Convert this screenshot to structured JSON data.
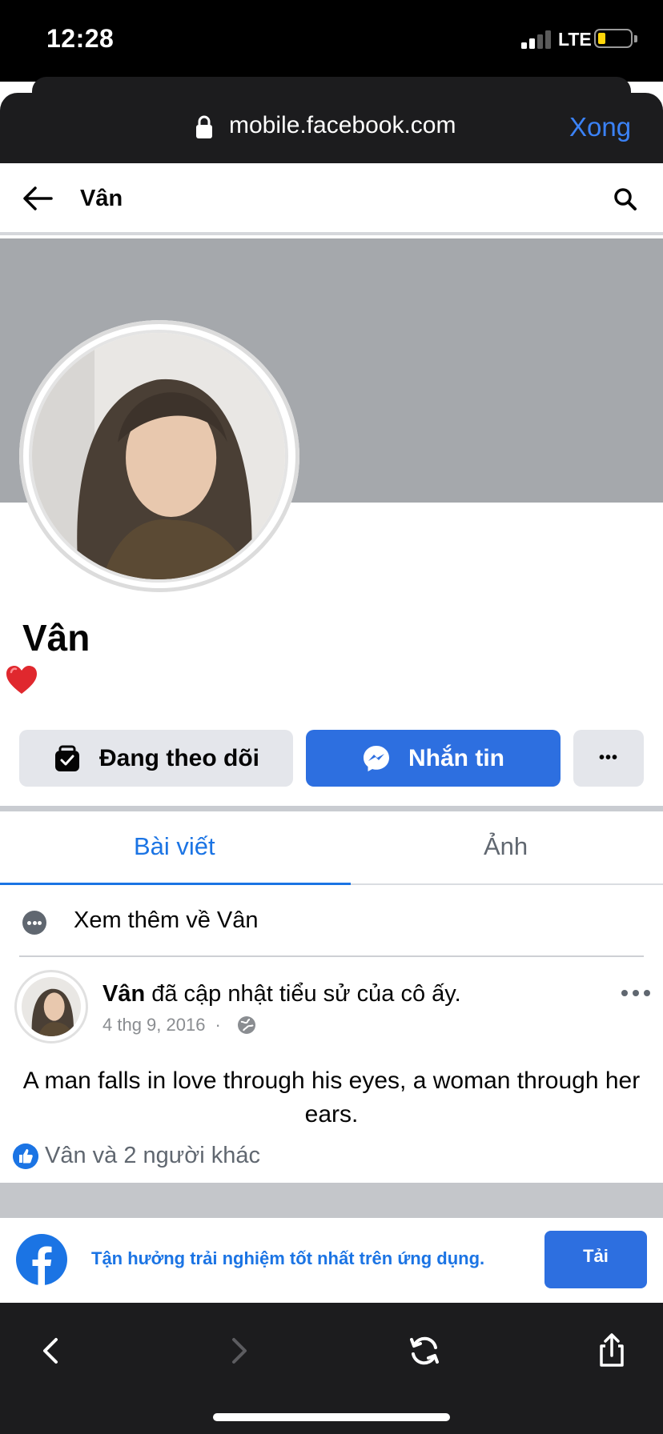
{
  "status_bar": {
    "time": "12:28",
    "network": "LTE",
    "battery_level": 0.15,
    "battery_color": "#ffd60a"
  },
  "browser": {
    "url": "mobile.facebook.com",
    "done_label": "Xong"
  },
  "topbar": {
    "title": "Vân"
  },
  "profile": {
    "name": "Vân",
    "bio_emoji": "heart-icon",
    "follow_label": "Đang theo dõi",
    "message_label": "Nhắn tin",
    "more_label": "•••"
  },
  "tabs": [
    {
      "label": "Bài viết",
      "active": true
    },
    {
      "label": "Ảnh",
      "active": false
    }
  ],
  "see_more": {
    "label": "Xem thêm về Vân"
  },
  "post": {
    "author": "Vân",
    "action": " đã cập nhật tiểu sử của cô ấy.",
    "date": "4 thg 9, 2016",
    "separator": "·",
    "privacy_icon": "globe-icon",
    "body": "A man falls in love through his eyes, a woman through her ears.",
    "reactions_text": "Vân và 2 người khác"
  },
  "app_banner": {
    "text": "Tận hưởng trải nghiệm tốt nhất trên ứng dụng.",
    "install_label": "Tải"
  },
  "colors": {
    "facebook_blue": "#1b74e4",
    "button_blue": "#2d6fe0",
    "cover_gray": "#a5a8ac",
    "safari_dark": "#1c1c1e",
    "safari_link": "#3b82f6"
  }
}
